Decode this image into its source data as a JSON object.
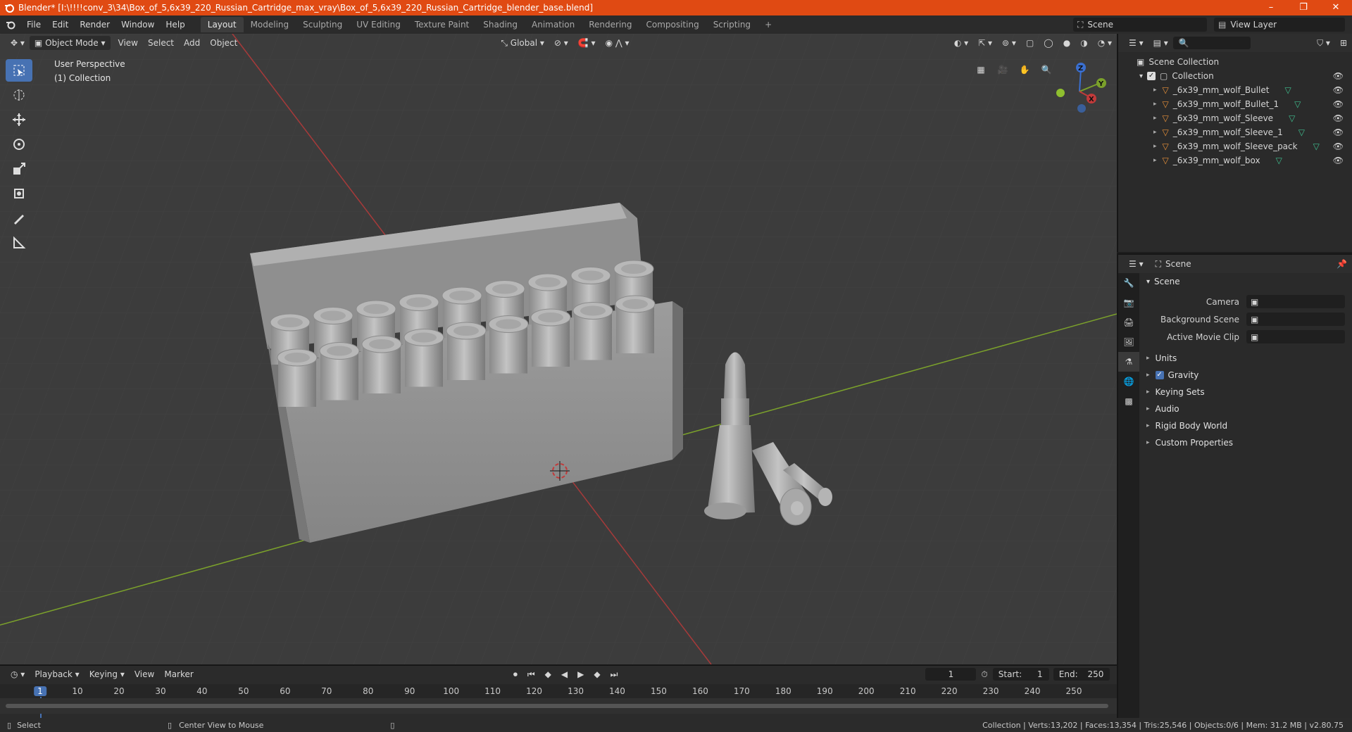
{
  "window": {
    "title": "Blender* [I:\\!!!!conv_3\\34\\Box_of_5,6x39_220_Russian_Cartridge_max_vray\\Box_of_5,6x39_220_Russian_Cartridge_blender_base.blend]",
    "controls": [
      "–",
      "❐",
      "✕"
    ]
  },
  "menu": [
    "File",
    "Edit",
    "Render",
    "Window",
    "Help"
  ],
  "workspaces": [
    {
      "label": "Layout",
      "active": true
    },
    {
      "label": "Modeling"
    },
    {
      "label": "Sculpting"
    },
    {
      "label": "UV Editing"
    },
    {
      "label": "Texture Paint"
    },
    {
      "label": "Shading"
    },
    {
      "label": "Animation"
    },
    {
      "label": "Rendering"
    },
    {
      "label": "Compositing"
    },
    {
      "label": "Scripting"
    }
  ],
  "add_workspace": "+",
  "scene_selector": "Scene",
  "view_layer_selector": "View Layer",
  "viewport": {
    "mode": "Object Mode",
    "menus": [
      "View",
      "Select",
      "Add",
      "Object"
    ],
    "transform_orientation": "Global",
    "perspective_label": "User Perspective",
    "collection_label": "(1) Collection",
    "gizmo": {
      "x": "X",
      "y": "Y",
      "z": "Z"
    }
  },
  "outliner": {
    "root": "Scene Collection",
    "collection": "Collection",
    "objects": [
      "_6x39_mm_wolf_Bullet",
      "_6x39_mm_wolf_Bullet_1",
      "_6x39_mm_wolf_Sleeve",
      "_6x39_mm_wolf_Sleeve_1",
      "_6x39_mm_wolf_Sleeve_pack",
      "_6x39_mm_wolf_box"
    ]
  },
  "properties": {
    "context": "Scene",
    "panel": "Scene",
    "fields": [
      {
        "label": "Camera",
        "value": ""
      },
      {
        "label": "Background Scene",
        "value": ""
      },
      {
        "label": "Active Movie Clip",
        "value": ""
      }
    ],
    "sections": [
      {
        "label": "Units",
        "checkbox": false
      },
      {
        "label": "Gravity",
        "checkbox": true
      },
      {
        "label": "Keying Sets",
        "checkbox": false
      },
      {
        "label": "Audio",
        "checkbox": false
      },
      {
        "label": "Rigid Body World",
        "checkbox": false
      },
      {
        "label": "Custom Properties",
        "checkbox": false
      }
    ]
  },
  "timeline": {
    "menus": [
      "Playback",
      "Keying",
      "View",
      "Marker"
    ],
    "current_frame": "1",
    "start_label": "Start:",
    "start": "1",
    "end_label": "End:",
    "end": "250",
    "ruler": [
      "1",
      "10",
      "20",
      "30",
      "40",
      "50",
      "60",
      "70",
      "80",
      "90",
      "100",
      "110",
      "120",
      "130",
      "140",
      "150",
      "160",
      "170",
      "180",
      "190",
      "200",
      "210",
      "220",
      "230",
      "240",
      "250"
    ]
  },
  "statusbar": {
    "left_action": "Select",
    "middle_action": "Center View to Mouse",
    "stats": "Collection | Verts:13,202 | Faces:13,354 | Tris:25,546 | Objects:0/6 | Mem: 31.2 MB | v2.80.75"
  },
  "colors": {
    "titlebar": "#e04a13",
    "accent": "#4772b3",
    "x_axis": "#c23a3a",
    "y_axis": "#7ba12b",
    "z_axis": "#3a6fd0"
  }
}
